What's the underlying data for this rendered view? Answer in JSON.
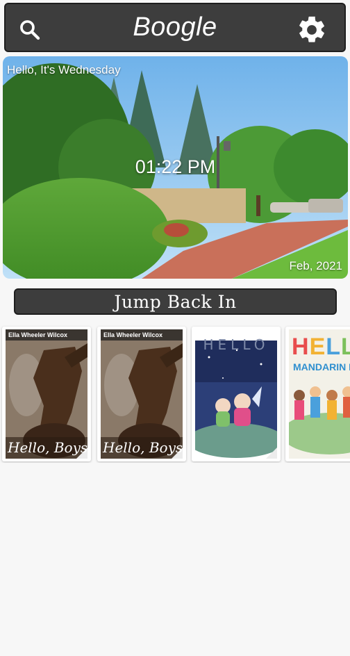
{
  "app_bar": {
    "title": "Boogle",
    "search_icon": "search-icon",
    "settings_icon": "gear-icon"
  },
  "hero": {
    "greeting": "Hello, It's Wednesday",
    "time": "01:22 PM",
    "date": "Feb, 2021"
  },
  "section": {
    "title": "Jump Back In"
  },
  "books": [
    {
      "author": "Ella Wheeler Wilcox",
      "title": "Hello, Boys!"
    },
    {
      "author": "Ella Wheeler Wilcox",
      "title": "Hello, Boys!"
    },
    {
      "title": "HELLO"
    },
    {
      "title": "HELLO",
      "subtitle": "MANDARIN D"
    }
  ],
  "colors": {
    "bar": "#3d3d3d",
    "background": "#f7f7f7"
  }
}
